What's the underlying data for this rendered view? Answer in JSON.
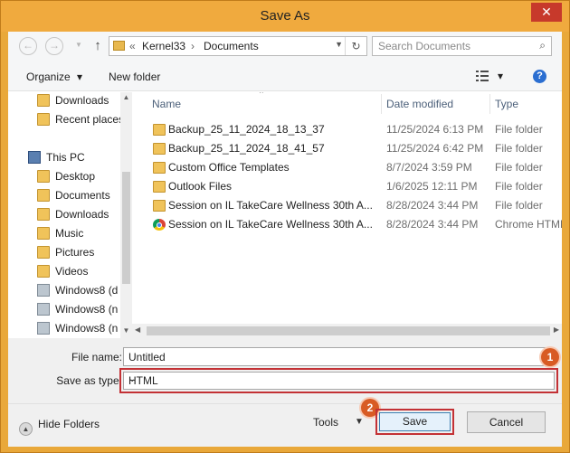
{
  "window": {
    "title": "Save As",
    "close_glyph": "✕"
  },
  "address": {
    "back_glyph": "←",
    "forward_glyph": "→",
    "up_glyph": "↑",
    "overflow": "«",
    "crumbs": [
      "Kernel33",
      "Documents"
    ],
    "separator": "›",
    "refresh_glyph": "↻",
    "dropdown_glyph": "▼"
  },
  "search": {
    "placeholder": "Search Documents",
    "icon": "⌕"
  },
  "toolbar": {
    "organize": "Organize",
    "organize_caret": "▾",
    "new_folder": "New folder",
    "view_caret": "▾",
    "help": "?"
  },
  "nav": {
    "items": [
      {
        "label": "Downloads",
        "icon": "folder"
      },
      {
        "label": "Recent places",
        "icon": "folder"
      },
      {
        "label": "This PC",
        "icon": "pc"
      },
      {
        "label": "Desktop",
        "icon": "folder"
      },
      {
        "label": "Documents",
        "icon": "folder"
      },
      {
        "label": "Downloads",
        "icon": "folder"
      },
      {
        "label": "Music",
        "icon": "folder"
      },
      {
        "label": "Pictures",
        "icon": "folder"
      },
      {
        "label": "Videos",
        "icon": "folder"
      },
      {
        "label": "Windows8 (d",
        "icon": "drive"
      },
      {
        "label": "Windows8 (n",
        "icon": "drive"
      },
      {
        "label": "Windows8 (n",
        "icon": "drive"
      }
    ],
    "scroll_up": "▲",
    "scroll_down": "▼"
  },
  "files": {
    "columns": [
      "Name",
      "Date modified",
      "Type"
    ],
    "sort_caret": "^",
    "rows": [
      {
        "name": "Backup_25_11_2024_18_13_37",
        "date": "11/25/2024 6:13 PM",
        "type": "File folder",
        "icon": "folder"
      },
      {
        "name": "Backup_25_11_2024_18_41_57",
        "date": "11/25/2024 6:42 PM",
        "type": "File folder",
        "icon": "folder"
      },
      {
        "name": "Custom Office Templates",
        "date": "8/7/2024 3:59 PM",
        "type": "File folder",
        "icon": "folder"
      },
      {
        "name": "Outlook Files",
        "date": "1/6/2025 12:11 PM",
        "type": "File folder",
        "icon": "folder"
      },
      {
        "name": "Session on IL TakeCare  Wellness  30th A...",
        "date": "8/28/2024 3:44 PM",
        "type": "File folder",
        "icon": "folder"
      },
      {
        "name": "Session on IL TakeCare  Wellness  30th A...",
        "date": "8/28/2024 3:44 PM",
        "type": "Chrome HTML",
        "icon": "chrome"
      }
    ],
    "scroll_left": "◀",
    "scroll_right": "▶"
  },
  "fields": {
    "file_name_label": "File name:",
    "file_name_value": "Untitled",
    "save_type_label": "Save as type:",
    "save_type_value": "HTML",
    "dropdown_glyph": "⌄"
  },
  "badges": {
    "one": "1",
    "two": "2"
  },
  "bottom": {
    "hide_folders": "Hide Folders",
    "hide_glyph": "▲",
    "tools": "Tools",
    "tools_caret": "▼",
    "save": "Save",
    "cancel": "Cancel"
  },
  "colors": {
    "title_bar": "#f0aa3e",
    "highlight": "#c33135",
    "badge": "#d85b24",
    "close": "#c7392b"
  }
}
